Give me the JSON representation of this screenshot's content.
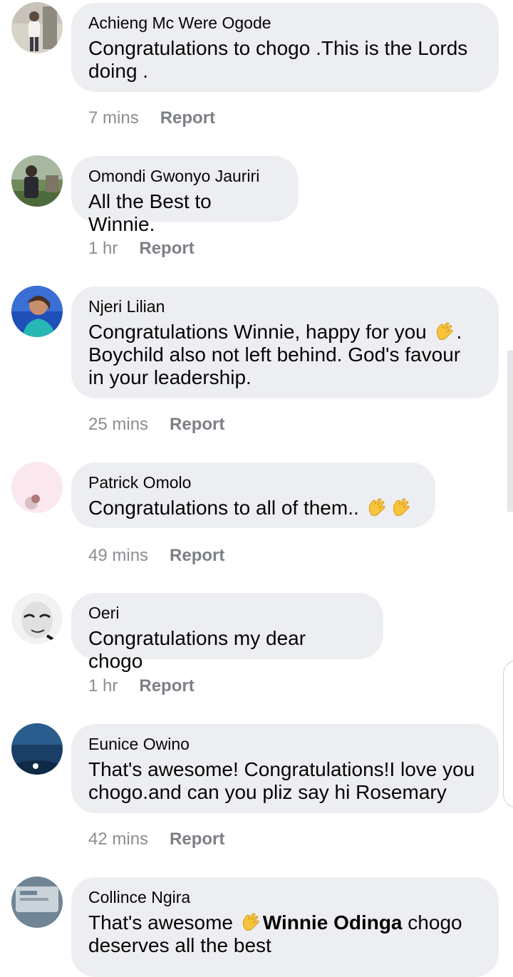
{
  "comments": [
    {
      "author": "Achieng Mc Were Ogode",
      "text": "Congratulations to chogo .This is the Lords doing .",
      "time": "7 mins",
      "report": "Report",
      "avatar_icon": "person-photo-avatar"
    },
    {
      "author": "Omondi Gwonyo Jauriri",
      "text": "All the Best to Winnie.",
      "time": "1 hr",
      "report": "Report",
      "avatar_icon": "person-outdoor-avatar"
    },
    {
      "author": "Njeri Lilian",
      "text_before": "Congratulations Winnie, happy for you ",
      "text_after": ". Boychild also not left behind. God's favour in your leadership.",
      "time": "25 mins",
      "report": "Report",
      "avatar_icon": "woman-portrait-avatar"
    },
    {
      "author": "Patrick Omolo",
      "text": "Congratulations to all of them.. ",
      "time": "49 mins",
      "report": "Report",
      "avatar_icon": "pink-avatar"
    },
    {
      "author": "Oeri",
      "text": "Congratulations my dear chogo",
      "time": "1 hr",
      "report": "Report",
      "avatar_icon": "sketch-face-avatar"
    },
    {
      "author": "Eunice Owino",
      "text": "That's awesome! Congratulations!I love you chogo.and can you pliz say hi Rosemary",
      "time": "42 mins",
      "report": "Report",
      "avatar_icon": "blue-night-avatar"
    },
    {
      "author": "Collince Ngira",
      "text_before": "That's awesome ",
      "mention": "Winnie Odinga",
      "text_after": " chogo deserves all the best",
      "avatar_icon": "grey-card-avatar"
    }
  ],
  "emoji": "clapping-hands",
  "colors": {
    "bubble": "#edeef1",
    "meta": "#8a8d91",
    "text": "#050505"
  }
}
